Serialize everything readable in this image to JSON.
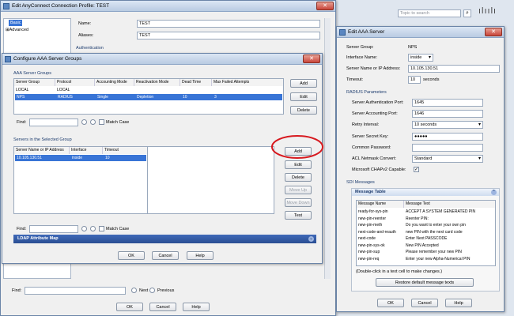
{
  "main_window": {
    "title": "Edit AnyConnect Connection Profile: TEST",
    "search_placeholder": "Topic to search",
    "tree": {
      "basic": "Basic",
      "advanced": "Advanced"
    },
    "name_label": "Name:",
    "name_value": "TEST",
    "aliases_label": "Aliases:",
    "aliases_value": "TEST",
    "auth_section": "Authentication",
    "find_label": "Find:",
    "next": "Next",
    "previous": "Previous",
    "ok": "OK",
    "cancel": "Cancel",
    "help": "Help"
  },
  "aaa_groups": {
    "title": "Configure AAA Server Groups",
    "section": "AAA Server Groups",
    "columns": [
      "Server Group",
      "Protocol",
      "Accounting Mode",
      "Reactivation Mode",
      "Dead Time",
      "Max Failed Attempts"
    ],
    "rows": [
      [
        "LOCAL",
        "LOCAL",
        "",
        "",
        "",
        ""
      ],
      [
        "NPS",
        "RADIUS",
        "Single",
        "Depletion",
        "10",
        "3"
      ]
    ],
    "buttons": {
      "add": "Add",
      "edit": "Edit",
      "delete": "Delete"
    },
    "find_label": "Find:",
    "match_case": "Match Case",
    "servers_section": "Servers in the Selected Group",
    "server_columns": [
      "Server Name or IP Address",
      "Interface",
      "Timeout"
    ],
    "server_rows": [
      [
        "10.105.130.51",
        "inside",
        "10"
      ]
    ],
    "server_buttons": {
      "add": "Add",
      "edit": "Edit",
      "delete": "Delete",
      "move_up": "Move Up",
      "move_down": "Move Down",
      "test": "Test"
    },
    "ldap_bar": "LDAP Attribute Map",
    "ok": "OK",
    "cancel": "Cancel",
    "help": "Help"
  },
  "edit_aaa": {
    "title": "Edit AAA Server",
    "server_group_label": "Server Group:",
    "server_group_value": "NPS",
    "interface_label": "Interface Name:",
    "interface_value": "inside",
    "ip_label": "Server Name or IP Address:",
    "ip_value": "10.105.130.51",
    "timeout_label": "Timeout:",
    "timeout_value": "10",
    "timeout_unit": "seconds",
    "radius_section": "RADIUS Parameters",
    "auth_port_label": "Server Authentication Port:",
    "auth_port_value": "1645",
    "acct_port_label": "Server Accounting Port:",
    "acct_port_value": "1646",
    "retry_label": "Retry Interval:",
    "retry_value": "10 seconds",
    "secret_label": "Server Secret Key:",
    "secret_value": "●●●●●",
    "common_pw_label": "Common Password:",
    "common_pw_value": "",
    "acl_label": "ACL Netmask Convert:",
    "acl_value": "Standard",
    "chap_label": "Microsoft CHAPv2 Capable:",
    "sdi_section": "SDI Messages",
    "msg_table_title": "Message Table",
    "msg_columns": [
      "Message Name",
      "Message Text"
    ],
    "messages": [
      [
        "ready-for-sys-pin",
        "ACCEPT A SYSTEM GENERATED PIN"
      ],
      [
        "new-pin-reenter",
        "Reenter PIN:"
      ],
      [
        "new-pin-meth",
        "Do you want to enter your own pin"
      ],
      [
        "next-code-and-reauth",
        "new PIN with the next card code"
      ],
      [
        "next-code",
        "Enter Next PASSCODE"
      ],
      [
        "new-pin-sys-ok",
        "New PIN Accepted"
      ],
      [
        "new-pin-sup",
        "Please remember your new PIN"
      ],
      [
        "new-pin-req",
        "Enter your new Alpha-Numerical PIN"
      ]
    ],
    "hint": "(Double-click in a text cell to make changes.)",
    "restore": "Restore default message texts",
    "ok": "OK",
    "cancel": "Cancel",
    "help": "Help"
  }
}
